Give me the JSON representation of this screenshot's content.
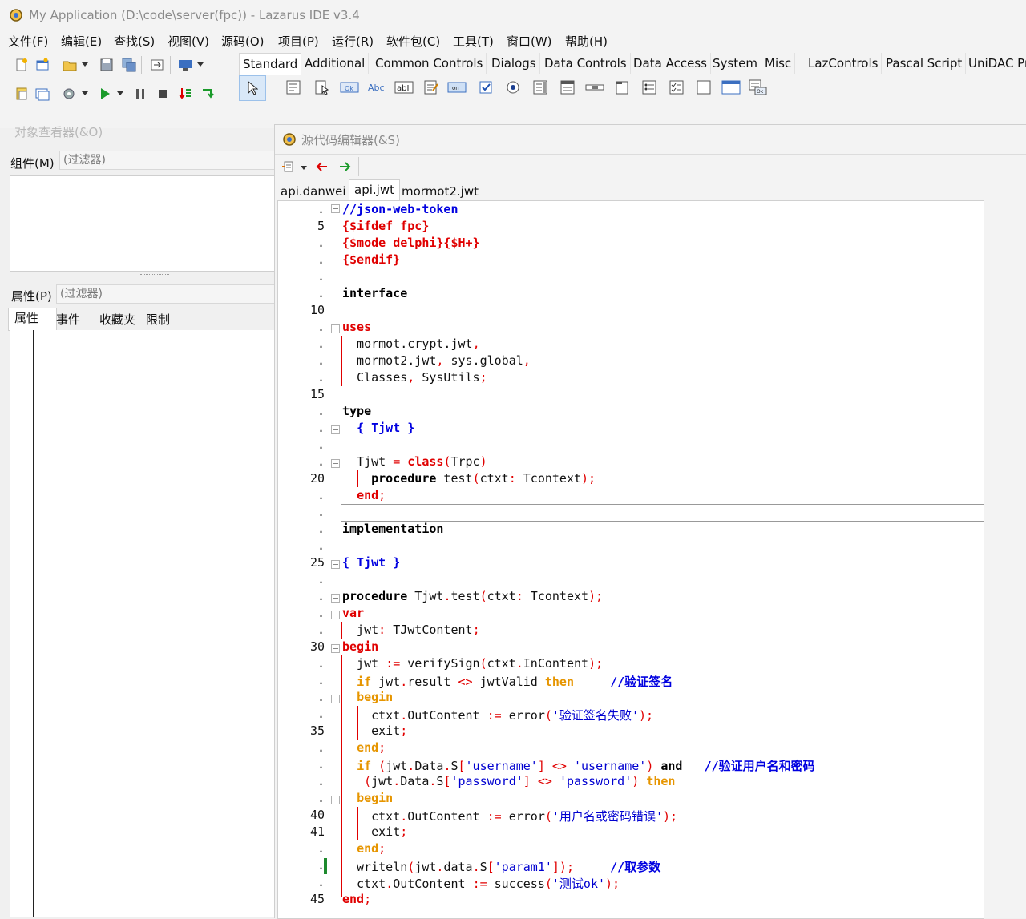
{
  "window": {
    "title": "My Application (D:\\code\\server(fpc)) - Lazarus IDE v3.4"
  },
  "menu": [
    "文件(F)",
    "编辑(E)",
    "查找(S)",
    "视图(V)",
    "源码(O)",
    "项目(P)",
    "运行(R)",
    "软件包(C)",
    "工具(T)",
    "窗口(W)",
    "帮助(H)"
  ],
  "palette": {
    "tabs": [
      "Standard",
      "Additional",
      "Common Controls",
      "Dialogs",
      "Data Controls",
      "Data Access",
      "System",
      "Misc",
      "LazControls",
      "Pascal Script",
      "UniDAC Pr"
    ],
    "active_tab": "Standard"
  },
  "inspector": {
    "title": "对象查看器(&O)",
    "components_label": "组件(M)",
    "components_filter_placeholder": "(过滤器)",
    "properties_label": "属性(P)",
    "properties_filter_placeholder": "(过滤器)",
    "tabs": [
      "属性",
      "事件",
      "收藏夹",
      "限制"
    ]
  },
  "editor": {
    "title": "源代码编辑器(&S)",
    "tabs": [
      "api.danwei",
      "api.jwt",
      "mormot2.jwt"
    ],
    "active_tab": "api.jwt",
    "gutter": [
      ".",
      "5",
      ".",
      ".",
      ".",
      ".",
      "10",
      ".",
      ".",
      ".",
      ".",
      "15",
      ".",
      ".",
      ".",
      ".",
      "20",
      ".",
      ".",
      ".",
      ".",
      "25",
      ".",
      ".",
      ".",
      ".",
      "30",
      ".",
      ".",
      ".",
      ".",
      "35",
      ".",
      ".",
      ".",
      ".",
      "40",
      "41",
      ".",
      ".",
      ".",
      "45"
    ],
    "code": [
      [
        [
          "cmt",
          "//json-web-token"
        ]
      ],
      [
        [
          "dir",
          "{$ifdef fpc}"
        ]
      ],
      [
        [
          "dir",
          "{$mode delphi}{$H+}"
        ]
      ],
      [
        [
          "dir",
          "{$endif}"
        ]
      ],
      [],
      [
        [
          "kw",
          "interface"
        ]
      ],
      [],
      [
        [
          "kwr",
          "uses"
        ]
      ],
      [
        [
          "",
          "  mormot.crypt.jwt"
        ],
        [
          "sym",
          ","
        ]
      ],
      [
        [
          "",
          "  mormot2.jwt"
        ],
        [
          "sym",
          ","
        ],
        [
          "",
          " sys.global"
        ],
        [
          "sym",
          ","
        ]
      ],
      [
        [
          "",
          "  Classes"
        ],
        [
          "sym",
          ","
        ],
        [
          "",
          " SysUtils"
        ],
        [
          "sym",
          ";"
        ]
      ],
      [],
      [
        [
          "kw",
          "type"
        ]
      ],
      [
        [
          "",
          "  "
        ],
        [
          "cmt",
          "{ Tjwt }"
        ]
      ],
      [],
      [
        [
          "",
          "  Tjwt "
        ],
        [
          "sym",
          "="
        ],
        [
          "",
          " "
        ],
        [
          "kwr",
          "class"
        ],
        [
          "sym",
          "("
        ],
        [
          "",
          "Trpc"
        ],
        [
          "sym",
          ")"
        ]
      ],
      [
        [
          "",
          "    "
        ],
        [
          "kw",
          "procedure"
        ],
        [
          "",
          " test"
        ],
        [
          "sym",
          "("
        ],
        [
          "",
          "ctxt"
        ],
        [
          "sym",
          ":"
        ],
        [
          "",
          " Tcontext"
        ],
        [
          "sym",
          ");"
        ]
      ],
      [
        [
          "",
          "  "
        ],
        [
          "kwr",
          "end"
        ],
        [
          "sym",
          ";"
        ]
      ],
      [],
      [
        [
          "kw",
          "implementation"
        ]
      ],
      [],
      [
        [
          "cmt",
          "{ Tjwt }"
        ]
      ],
      [],
      [
        [
          "kw",
          "procedure"
        ],
        [
          "",
          " Tjwt"
        ],
        [
          "sym",
          "."
        ],
        [
          "",
          "test"
        ],
        [
          "sym",
          "("
        ],
        [
          "",
          "ctxt"
        ],
        [
          "sym",
          ":"
        ],
        [
          "",
          " Tcontext"
        ],
        [
          "sym",
          ");"
        ]
      ],
      [
        [
          "kwr",
          "var"
        ]
      ],
      [
        [
          "",
          "  jwt"
        ],
        [
          "sym",
          ":"
        ],
        [
          "",
          " TJwtContent"
        ],
        [
          "sym",
          ";"
        ]
      ],
      [
        [
          "kwr",
          "begin"
        ]
      ],
      [
        [
          "",
          "  jwt "
        ],
        [
          "sym",
          ":="
        ],
        [
          "",
          " verifySign"
        ],
        [
          "sym",
          "("
        ],
        [
          "",
          "ctxt"
        ],
        [
          "sym",
          "."
        ],
        [
          "",
          "InContent"
        ],
        [
          "sym",
          ");"
        ]
      ],
      [
        [
          "",
          "  "
        ],
        [
          "kwo",
          "if"
        ],
        [
          "",
          " jwt"
        ],
        [
          "sym",
          "."
        ],
        [
          "",
          "result "
        ],
        [
          "sym",
          "<>"
        ],
        [
          "",
          " jwtValid "
        ],
        [
          "kwo",
          "then"
        ],
        [
          "",
          "     "
        ],
        [
          "cmt",
          "//验证签名"
        ]
      ],
      [
        [
          "",
          "  "
        ],
        [
          "kwo",
          "begin"
        ]
      ],
      [
        [
          "",
          "    ctxt"
        ],
        [
          "sym",
          "."
        ],
        [
          "",
          "OutContent "
        ],
        [
          "sym",
          ":="
        ],
        [
          "",
          " error"
        ],
        [
          "sym",
          "("
        ],
        [
          "str",
          "'验证签名失败'"
        ],
        [
          "sym",
          ");"
        ]
      ],
      [
        [
          "",
          "    exit"
        ],
        [
          "sym",
          ";"
        ]
      ],
      [
        [
          "",
          "  "
        ],
        [
          "kwo",
          "end"
        ],
        [
          "sym",
          ";"
        ]
      ],
      [
        [
          "",
          "  "
        ],
        [
          "kwo",
          "if"
        ],
        [
          "",
          " "
        ],
        [
          "sym",
          "("
        ],
        [
          "",
          "jwt"
        ],
        [
          "sym",
          "."
        ],
        [
          "",
          "Data"
        ],
        [
          "sym",
          "."
        ],
        [
          "",
          "S"
        ],
        [
          "sym",
          "["
        ],
        [
          "str",
          "'username'"
        ],
        [
          "sym",
          "]"
        ],
        [
          "",
          " "
        ],
        [
          "sym",
          "<>"
        ],
        [
          "",
          " "
        ],
        [
          "str",
          "'username'"
        ],
        [
          "sym",
          ")"
        ],
        [
          "",
          " "
        ],
        [
          "kw",
          "and"
        ],
        [
          "",
          "   "
        ],
        [
          "cmt",
          "//验证用户名和密码"
        ]
      ],
      [
        [
          "",
          "   "
        ],
        [
          "sym",
          "("
        ],
        [
          "",
          "jwt"
        ],
        [
          "sym",
          "."
        ],
        [
          "",
          "Data"
        ],
        [
          "sym",
          "."
        ],
        [
          "",
          "S"
        ],
        [
          "sym",
          "["
        ],
        [
          "str",
          "'password'"
        ],
        [
          "sym",
          "]"
        ],
        [
          "",
          " "
        ],
        [
          "sym",
          "<>"
        ],
        [
          "",
          " "
        ],
        [
          "str",
          "'password'"
        ],
        [
          "sym",
          ")"
        ],
        [
          "",
          " "
        ],
        [
          "kwo",
          "then"
        ]
      ],
      [
        [
          "",
          "  "
        ],
        [
          "kwo",
          "begin"
        ]
      ],
      [
        [
          "",
          "    ctxt"
        ],
        [
          "sym",
          "."
        ],
        [
          "",
          "OutContent "
        ],
        [
          "sym",
          ":="
        ],
        [
          "",
          " error"
        ],
        [
          "sym",
          "("
        ],
        [
          "str",
          "'用户名或密码错误'"
        ],
        [
          "sym",
          ");"
        ]
      ],
      [
        [
          "",
          "    exit"
        ],
        [
          "sym",
          ";"
        ]
      ],
      [
        [
          "",
          "  "
        ],
        [
          "kwo",
          "end"
        ],
        [
          "sym",
          ";"
        ]
      ],
      [
        [
          "",
          "  writeln"
        ],
        [
          "sym",
          "("
        ],
        [
          "",
          "jwt"
        ],
        [
          "sym",
          "."
        ],
        [
          "",
          "data"
        ],
        [
          "sym",
          "."
        ],
        [
          "",
          "S"
        ],
        [
          "sym",
          "["
        ],
        [
          "str",
          "'param1'"
        ],
        [
          "sym",
          "]);"
        ],
        [
          "",
          "     "
        ],
        [
          "cmt",
          "//取参数"
        ]
      ],
      [
        [
          "",
          "  ctxt"
        ],
        [
          "sym",
          "."
        ],
        [
          "",
          "OutContent "
        ],
        [
          "sym",
          ":="
        ],
        [
          "",
          " success"
        ],
        [
          "sym",
          "("
        ],
        [
          "str",
          "'测试ok'"
        ],
        [
          "sym",
          ");"
        ]
      ],
      [
        [
          "kwr",
          "end"
        ],
        [
          "sym",
          ";"
        ]
      ]
    ]
  }
}
